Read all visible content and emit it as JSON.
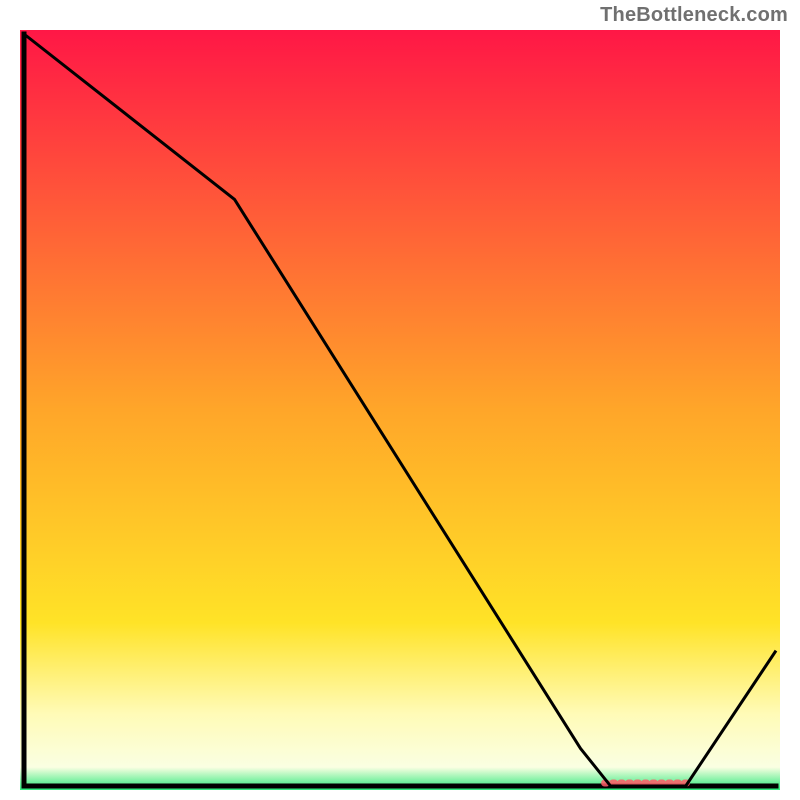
{
  "attribution": "TheBottleneck.com",
  "chart_data": {
    "type": "line",
    "title": "",
    "xlabel": "",
    "ylabel": "",
    "xlim": [
      0,
      100
    ],
    "ylim": [
      0,
      100
    ],
    "x": [
      0,
      28,
      74,
      78,
      88,
      100
    ],
    "values": [
      100,
      78,
      5,
      0,
      0,
      18
    ],
    "background_gradient": {
      "stops": [
        {
          "offset": 0.0,
          "color": "#ff1746"
        },
        {
          "offset": 0.5,
          "color": "#ffa629"
        },
        {
          "offset": 0.78,
          "color": "#ffe327"
        },
        {
          "offset": 0.9,
          "color": "#fffbb7"
        },
        {
          "offset": 0.97,
          "color": "#faffe2"
        },
        {
          "offset": 1.0,
          "color": "#2ae87a"
        }
      ]
    },
    "axis_color": "#000000",
    "line_color": "#000000",
    "line_width": 3,
    "marker": {
      "color": "#ff5a66",
      "opacity": 0.85
    }
  }
}
